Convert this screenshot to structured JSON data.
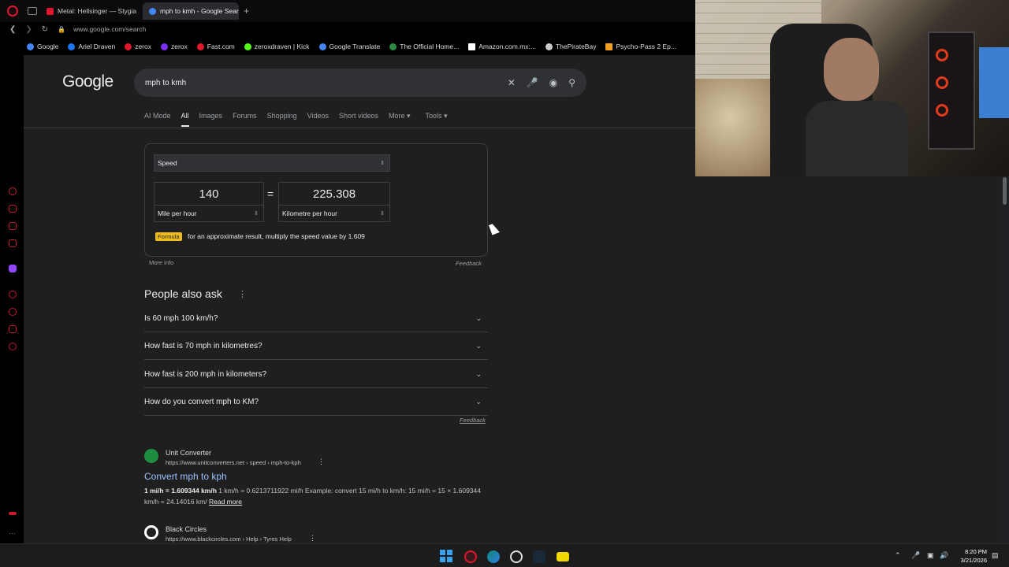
{
  "browser": {
    "tabs": [
      {
        "label": "Metal: Hellsinger — Stygia",
        "active": false,
        "favicon_color": "#e0172d"
      },
      {
        "label": "mph to kmh - Google Sear",
        "active": true,
        "favicon_color": "#4285f4"
      }
    ],
    "new_tab_label": "+",
    "url": "www.google.com/search",
    "bookmarks": [
      {
        "label": "Google",
        "color": "#4285f4"
      },
      {
        "label": "Ariel Draven",
        "color": "#1877f2"
      },
      {
        "label": "zerox",
        "color": "#e0172d"
      },
      {
        "label": "zerox",
        "color": "#7b2ff7"
      },
      {
        "label": "Fast.com",
        "color": "#e0172d"
      },
      {
        "label": "zeroxdraven | Kick",
        "color": "#53fc18"
      },
      {
        "label": "Google Translate",
        "color": "#4285f4"
      },
      {
        "label": "The Official Home...",
        "color": "#2b8a3e"
      },
      {
        "label": "Amazon.com.mx:...",
        "color": "#ffffff"
      },
      {
        "label": "ThePirateBay",
        "color": "#cccccc"
      },
      {
        "label": "Psycho-Pass 2 Ep...",
        "color": "#f0a020"
      }
    ]
  },
  "google": {
    "logo": "Google",
    "query": "mph to kmh",
    "tabs": [
      "AI Mode",
      "All",
      "Images",
      "Forums",
      "Shopping",
      "Videos",
      "Short videos",
      "More ▾",
      "Tools ▾"
    ],
    "converter": {
      "unit_type": "Speed",
      "from_value": "140",
      "to_value": "225.308",
      "equals": "=",
      "from_unit": "Mile per hour",
      "to_unit": "Kilometre per hour",
      "formula_badge": "Formula",
      "formula_text": "for an approximate result, multiply the speed value by 1.609",
      "more_info": "More info",
      "feedback": "Feedback"
    },
    "people_also_ask": {
      "title": "People also ask",
      "questions": [
        "Is 60 mph 100 km/h?",
        "How fast is 70 mph in kilometres?",
        "How fast is 200 mph in kilometers?",
        "How do you convert mph to KM?"
      ],
      "feedback": "Feedback"
    },
    "results": [
      {
        "site": "Unit Converter",
        "url": "https://www.unitconverters.net › speed › mph-to-kph",
        "title": "Convert mph to kph",
        "snippet_bold": "1 mi/h = 1.609344 km/h",
        "snippet": " 1 km/h = 0.6213711922 mi/h Example: convert 15 mi/h to km/h: 15 mi/h = 15 × 1.609344 km/h = 24.14016 km/ ",
        "read_more": "Read more",
        "favicon_color": "#1e8e3e"
      },
      {
        "site": "Black Circles",
        "url": "https://www.blackcircles.com › Help › Tyres Help",
        "favicon_color": "#ffffff"
      }
    ]
  },
  "taskbar": {
    "time": "8:20 PM",
    "date": "3/21/2026"
  }
}
